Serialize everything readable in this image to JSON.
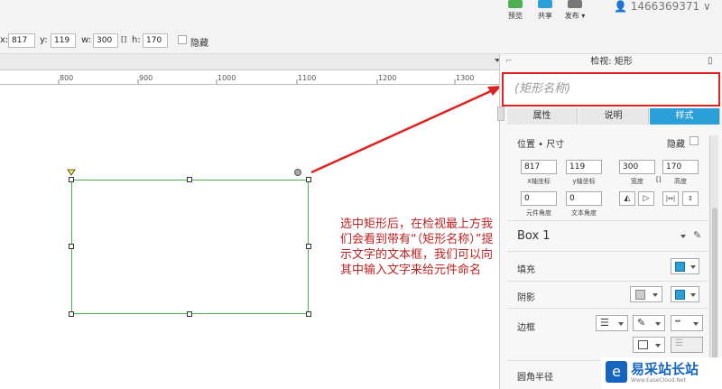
{
  "topbar": {
    "preview_label": "预览",
    "share_label": "共享",
    "publish_label": "发布 ▾",
    "user": "1466369371"
  },
  "props": {
    "x_label": "x:",
    "x_value": "817",
    "y_label": "y:",
    "y_value": "119",
    "w_label": "w:",
    "w_value": "300",
    "h_label": "h:",
    "h_value": "170",
    "hidden_label": "隐藏"
  },
  "ruler": {
    "ticks": [
      "800",
      "900",
      "1000",
      "1100",
      "1200",
      "1300"
    ]
  },
  "annotation": "选中矩形后，在检视最上方我们会看到带有“（矩形名称）”提示文字的文本框，我们可以向其中输入文字来给元件命名",
  "inspector": {
    "title": "检视: 矩形",
    "name_placeholder": "(矩形名称)",
    "tabs": [
      "属性",
      "说明",
      "样式"
    ],
    "active_tab": 2,
    "position_size_label": "位置 • 尺寸",
    "hidden_label": "隐藏",
    "x_value": "817",
    "x_label": "X轴坐标",
    "y_value": "119",
    "y_label": "y轴坐标",
    "w_value": "300",
    "w_label": "宽度",
    "h_value": "170",
    "h_label": "高度",
    "rot_value": "0",
    "rot_label": "元件角度",
    "text_rot_value": "0",
    "text_rot_label": "文本角度",
    "style_name": "Box 1",
    "fill_label": "填充",
    "shadow_label": "阴影",
    "border_label": "边框",
    "radius_label": "圆角半径",
    "accent_color": "#2a9fd8",
    "highlight_color": "#dd2222"
  },
  "watermark": {
    "text": "易采站长站",
    "sub": "Www.EaseCloud.Net"
  }
}
